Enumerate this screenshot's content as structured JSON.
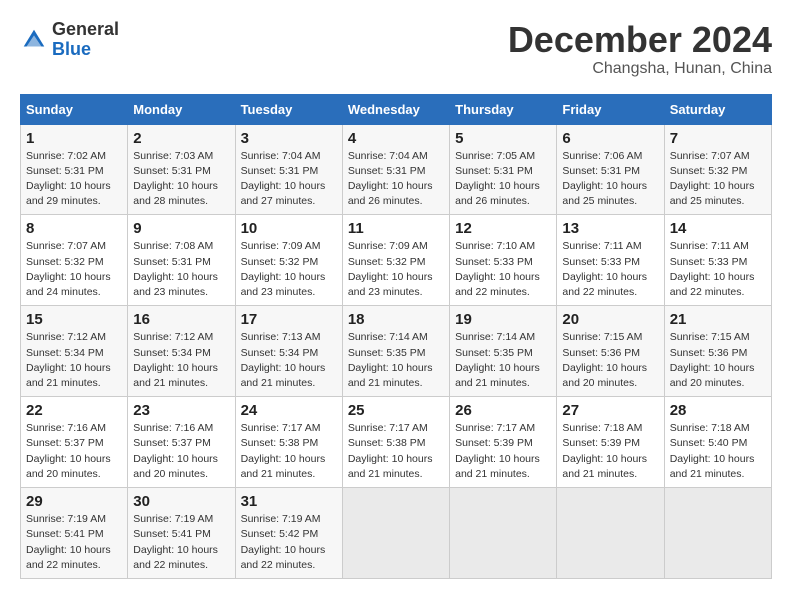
{
  "logo": {
    "general": "General",
    "blue": "Blue"
  },
  "title": "December 2024",
  "location": "Changsha, Hunan, China",
  "days_of_week": [
    "Sunday",
    "Monday",
    "Tuesday",
    "Wednesday",
    "Thursday",
    "Friday",
    "Saturday"
  ],
  "weeks": [
    [
      {
        "day": "1",
        "sunrise": "7:02 AM",
        "sunset": "5:31 PM",
        "daylight": "10 hours and 29 minutes."
      },
      {
        "day": "2",
        "sunrise": "7:03 AM",
        "sunset": "5:31 PM",
        "daylight": "10 hours and 28 minutes."
      },
      {
        "day": "3",
        "sunrise": "7:04 AM",
        "sunset": "5:31 PM",
        "daylight": "10 hours and 27 minutes."
      },
      {
        "day": "4",
        "sunrise": "7:04 AM",
        "sunset": "5:31 PM",
        "daylight": "10 hours and 26 minutes."
      },
      {
        "day": "5",
        "sunrise": "7:05 AM",
        "sunset": "5:31 PM",
        "daylight": "10 hours and 26 minutes."
      },
      {
        "day": "6",
        "sunrise": "7:06 AM",
        "sunset": "5:31 PM",
        "daylight": "10 hours and 25 minutes."
      },
      {
        "day": "7",
        "sunrise": "7:07 AM",
        "sunset": "5:32 PM",
        "daylight": "10 hours and 25 minutes."
      }
    ],
    [
      {
        "day": "8",
        "sunrise": "7:07 AM",
        "sunset": "5:32 PM",
        "daylight": "10 hours and 24 minutes."
      },
      {
        "day": "9",
        "sunrise": "7:08 AM",
        "sunset": "5:31 PM",
        "daylight": "10 hours and 23 minutes."
      },
      {
        "day": "10",
        "sunrise": "7:09 AM",
        "sunset": "5:32 PM",
        "daylight": "10 hours and 23 minutes."
      },
      {
        "day": "11",
        "sunrise": "7:09 AM",
        "sunset": "5:32 PM",
        "daylight": "10 hours and 23 minutes."
      },
      {
        "day": "12",
        "sunrise": "7:10 AM",
        "sunset": "5:33 PM",
        "daylight": "10 hours and 22 minutes."
      },
      {
        "day": "13",
        "sunrise": "7:11 AM",
        "sunset": "5:33 PM",
        "daylight": "10 hours and 22 minutes."
      },
      {
        "day": "14",
        "sunrise": "7:11 AM",
        "sunset": "5:33 PM",
        "daylight": "10 hours and 22 minutes."
      }
    ],
    [
      {
        "day": "15",
        "sunrise": "7:12 AM",
        "sunset": "5:34 PM",
        "daylight": "10 hours and 21 minutes."
      },
      {
        "day": "16",
        "sunrise": "7:12 AM",
        "sunset": "5:34 PM",
        "daylight": "10 hours and 21 minutes."
      },
      {
        "day": "17",
        "sunrise": "7:13 AM",
        "sunset": "5:34 PM",
        "daylight": "10 hours and 21 minutes."
      },
      {
        "day": "18",
        "sunrise": "7:14 AM",
        "sunset": "5:35 PM",
        "daylight": "10 hours and 21 minutes."
      },
      {
        "day": "19",
        "sunrise": "7:14 AM",
        "sunset": "5:35 PM",
        "daylight": "10 hours and 21 minutes."
      },
      {
        "day": "20",
        "sunrise": "7:15 AM",
        "sunset": "5:36 PM",
        "daylight": "10 hours and 20 minutes."
      },
      {
        "day": "21",
        "sunrise": "7:15 AM",
        "sunset": "5:36 PM",
        "daylight": "10 hours and 20 minutes."
      }
    ],
    [
      {
        "day": "22",
        "sunrise": "7:16 AM",
        "sunset": "5:37 PM",
        "daylight": "10 hours and 20 minutes."
      },
      {
        "day": "23",
        "sunrise": "7:16 AM",
        "sunset": "5:37 PM",
        "daylight": "10 hours and 20 minutes."
      },
      {
        "day": "24",
        "sunrise": "7:17 AM",
        "sunset": "5:38 PM",
        "daylight": "10 hours and 21 minutes."
      },
      {
        "day": "25",
        "sunrise": "7:17 AM",
        "sunset": "5:38 PM",
        "daylight": "10 hours and 21 minutes."
      },
      {
        "day": "26",
        "sunrise": "7:17 AM",
        "sunset": "5:39 PM",
        "daylight": "10 hours and 21 minutes."
      },
      {
        "day": "27",
        "sunrise": "7:18 AM",
        "sunset": "5:39 PM",
        "daylight": "10 hours and 21 minutes."
      },
      {
        "day": "28",
        "sunrise": "7:18 AM",
        "sunset": "5:40 PM",
        "daylight": "10 hours and 21 minutes."
      }
    ],
    [
      {
        "day": "29",
        "sunrise": "7:19 AM",
        "sunset": "5:41 PM",
        "daylight": "10 hours and 22 minutes."
      },
      {
        "day": "30",
        "sunrise": "7:19 AM",
        "sunset": "5:41 PM",
        "daylight": "10 hours and 22 minutes."
      },
      {
        "day": "31",
        "sunrise": "7:19 AM",
        "sunset": "5:42 PM",
        "daylight": "10 hours and 22 minutes."
      },
      null,
      null,
      null,
      null
    ]
  ],
  "labels": {
    "sunrise": "Sunrise:",
    "sunset": "Sunset:",
    "daylight": "Daylight:"
  }
}
